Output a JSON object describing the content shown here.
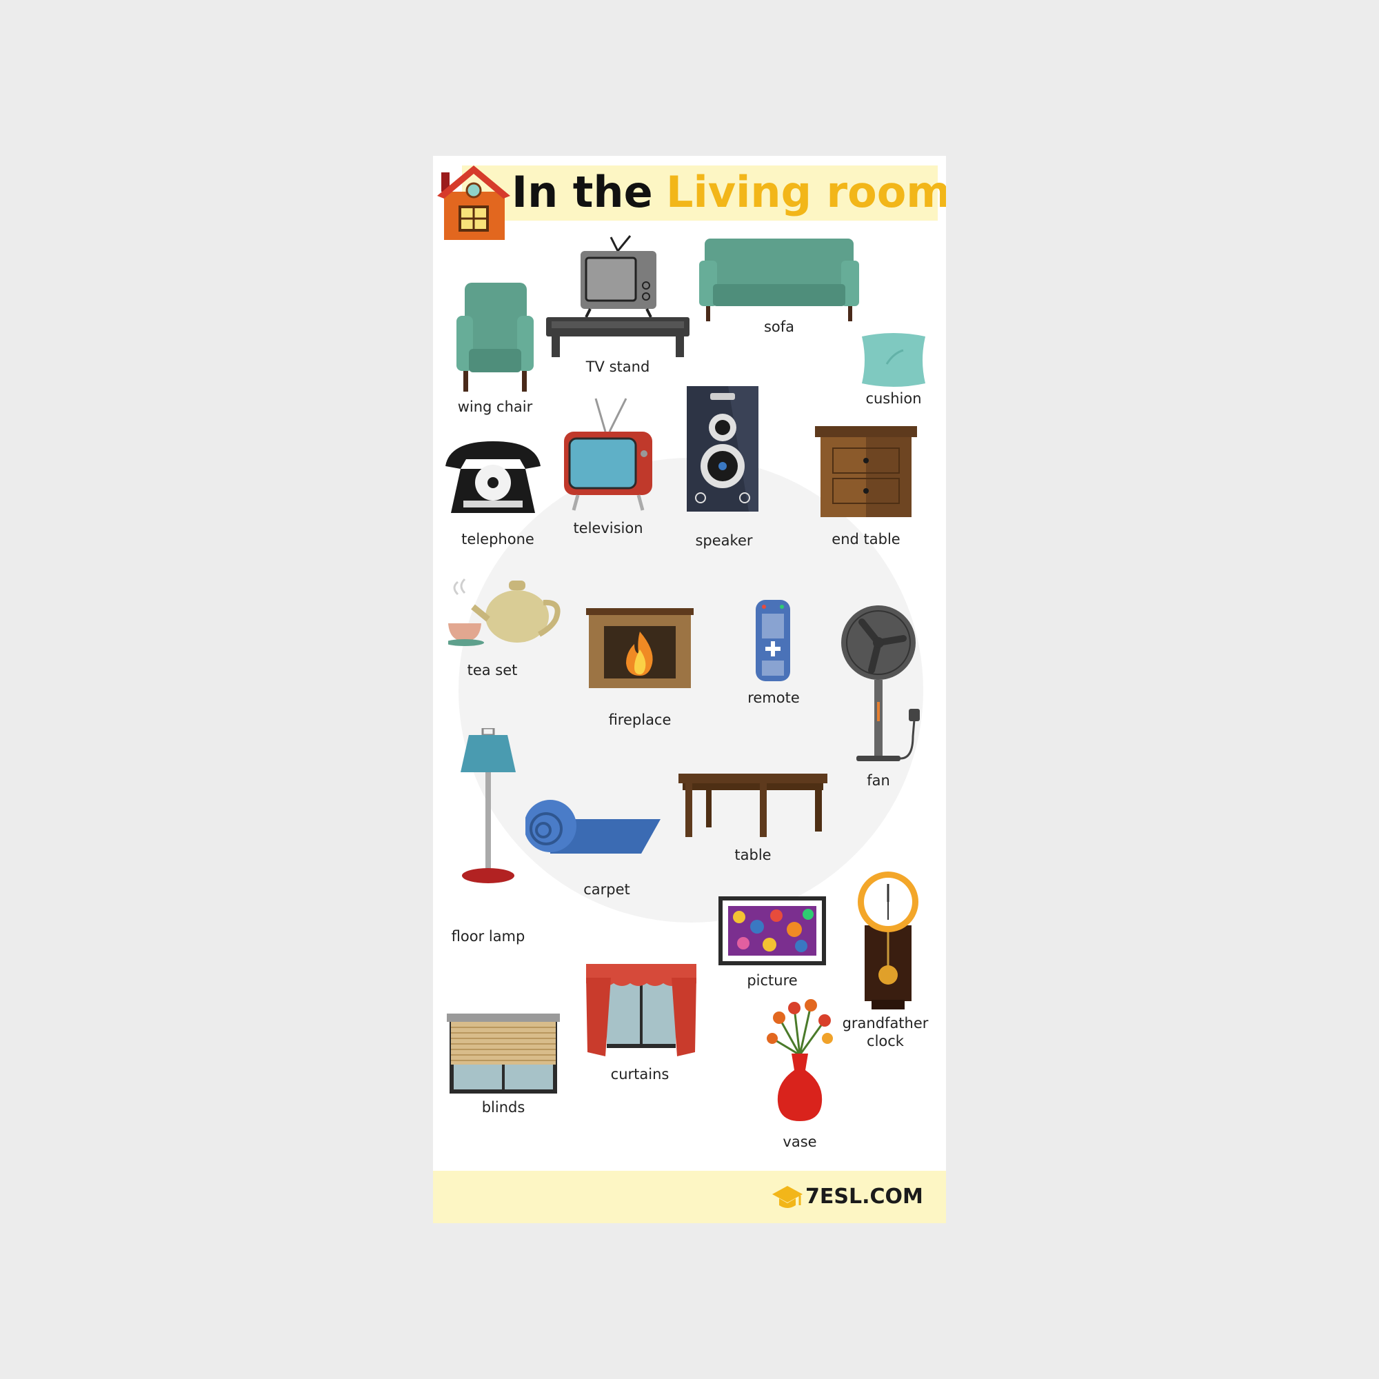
{
  "title": {
    "part1": "In the",
    "part2": "Living room"
  },
  "items": {
    "wing_chair": "wing chair",
    "tv_stand": "TV stand",
    "sofa": "sofa",
    "cushion": "cushion",
    "telephone": "telephone",
    "television": "television",
    "speaker": "speaker",
    "end_table": "end table",
    "tea_set": "tea set",
    "fireplace": "fireplace",
    "remote": "remote",
    "fan": "fan",
    "floor_lamp": "floor lamp",
    "carpet": "carpet",
    "table": "table",
    "picture": "picture",
    "grandfather_clock_1": "grandfather",
    "grandfather_clock_2": "clock",
    "blinds": "blinds",
    "curtains": "curtains",
    "vase": "vase"
  },
  "footer": {
    "logo": "7ESL.COM"
  },
  "colors": {
    "title_accent": "#f2b619",
    "banner": "#fdf6c4",
    "teal": "#5ea08c",
    "background": "#ececec"
  }
}
